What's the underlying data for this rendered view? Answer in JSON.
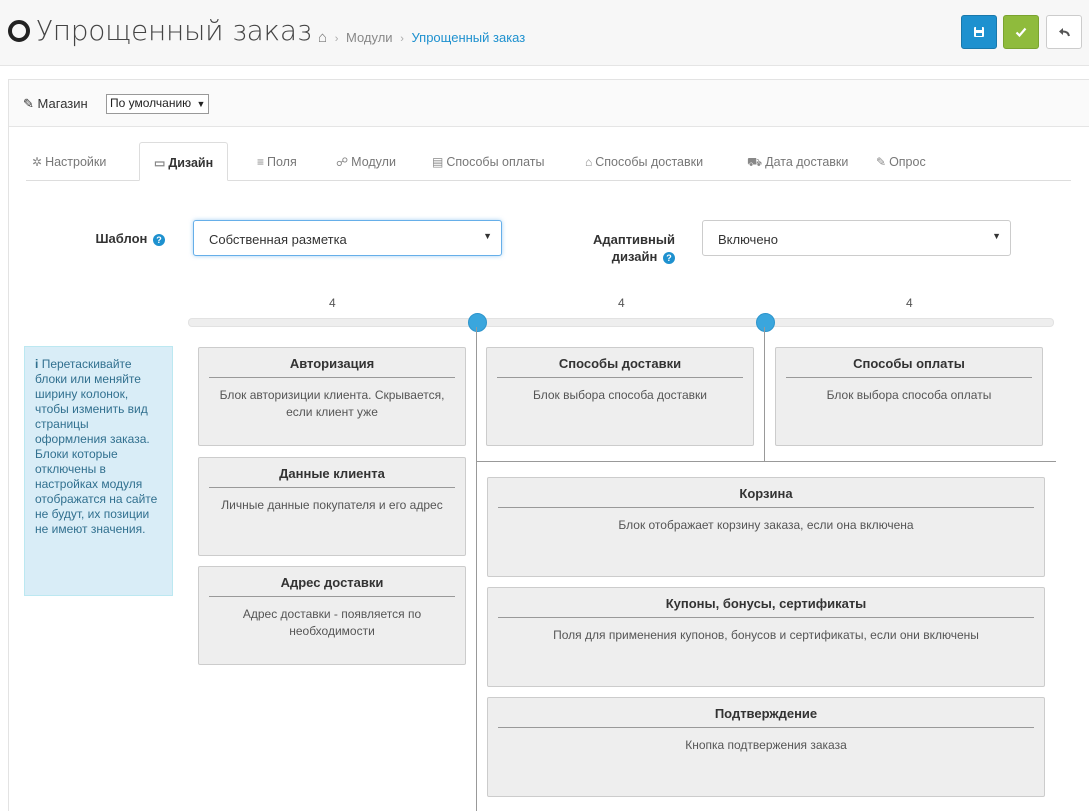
{
  "header": {
    "title": "Упрощенный заказ",
    "breadcrumb": [
      "Модули",
      "Упрощенный заказ"
    ],
    "buttons": {
      "save": "save",
      "apply": "check",
      "back": "back"
    }
  },
  "store": {
    "label": "Магазин",
    "selected": "По умолчанию"
  },
  "tabs": [
    {
      "label": "Настройки",
      "icon": "gear-icon"
    },
    {
      "label": "Дизайн",
      "icon": "monitor-icon"
    },
    {
      "label": "Поля",
      "icon": "list-icon"
    },
    {
      "label": "Модули",
      "icon": "sitemap-icon"
    },
    {
      "label": "Способы оплаты",
      "icon": "credit-card-icon"
    },
    {
      "label": "Способы доставки",
      "icon": "building-icon"
    },
    {
      "label": "Дата доставки",
      "icon": "truck-icon"
    },
    {
      "label": "Опрос",
      "icon": "edit-icon"
    }
  ],
  "form": {
    "template_label": "Шаблон",
    "template_value": "Собственная разметка",
    "adaptive_label_1": "Адаптивный",
    "adaptive_label_2": "дизайн",
    "adaptive_value": "Включено"
  },
  "columns": [
    "4",
    "4",
    "4"
  ],
  "info": {
    "text": "Перетаскивайте блоки или меняйте ширину колонок, чтобы изменить вид страницы оформления заказа. Блоки которые отключены в настройках модуля отображатся на сайте не будут, их позиции не имеют значения."
  },
  "blocks": {
    "auth": {
      "title": "Авторизация",
      "desc": "Блок авторизиции клиента. Скрывается, если клиент уже"
    },
    "customer": {
      "title": "Данные клиента",
      "desc": "Личные данные покупателя и его адрес"
    },
    "address": {
      "title": "Адрес доставки",
      "desc": "Адрес доставки - появляется по необходимости"
    },
    "shipping": {
      "title": "Способы доставки",
      "desc": "Блок выбора способа доставки"
    },
    "payment": {
      "title": "Способы оплаты",
      "desc": "Блок выбора способа оплаты"
    },
    "cart": {
      "title": "Корзина",
      "desc": "Блок отображает корзину заказа, если она включена"
    },
    "coupons": {
      "title": "Купоны, бонусы, сертификаты",
      "desc": "Поля для применения купонов, бонусов и сертификаты, если они включены"
    },
    "confirm": {
      "title": "Подтверждение",
      "desc": "Кнопка подтвержения заказа"
    }
  }
}
